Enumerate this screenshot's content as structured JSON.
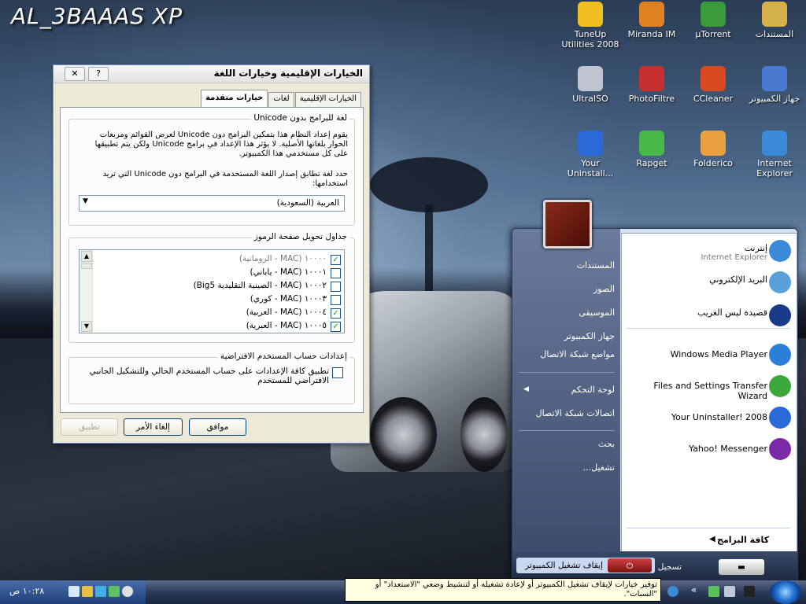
{
  "desktop": {
    "logo": "AL_3BAAAS XP",
    "icons": [
      {
        "label": "TuneUp Utilities 2008",
        "icon": "tuneup-icon",
        "color": "#f0c020"
      },
      {
        "label": "Miranda IM",
        "icon": "miranda-icon",
        "color": "#e08020"
      },
      {
        "label": "µTorrent",
        "icon": "utorrent-icon",
        "color": "#3a9a3a"
      },
      {
        "label": "المستندات",
        "icon": "documents-folder-icon",
        "color": "#d4b04a"
      },
      {
        "label": "UltraISO",
        "icon": "ultraiso-icon",
        "color": "#c0c4d0"
      },
      {
        "label": "PhotoFiltre",
        "icon": "photofiltre-icon",
        "color": "#c83030"
      },
      {
        "label": "CCleaner",
        "icon": "ccleaner-icon",
        "color": "#d84a20"
      },
      {
        "label": "جهاز الكمبيوتر",
        "icon": "my-computer-icon",
        "color": "#4a7ad0"
      },
      {
        "label": "Your Uninstall...",
        "icon": "your-uninstaller-icon",
        "color": "#2a6ad8"
      },
      {
        "label": "Rapget",
        "icon": "rapget-icon",
        "color": "#48b848"
      },
      {
        "label": "Folderico",
        "icon": "folderico-icon",
        "color": "#e8a040"
      },
      {
        "label": "Internet Explorer",
        "icon": "internet-explorer-icon",
        "color": "#3a8ad8"
      }
    ]
  },
  "dialog": {
    "title": "الخيارات الإقليمية وخيارات اللغة",
    "close_label": "✕",
    "help_label": "?",
    "tabs": [
      "الخيارات الإقليمية",
      "لغات",
      "خيارات متقدمة"
    ],
    "active_tab": "خيارات متقدمة",
    "unicode_group": {
      "title": "لغة للبرامج بدون Unicode",
      "description": "يقوم إعداد النظام هذا بتمكين البرامج دون Unicode لعرض القوائم ومربعات الحوار بلغاتها الأصلية. لا يؤثر هذا الإعداد في برامج Unicode ولكن يتم تطبيقها على كل مستخدمي هذا الكمبيوتر.",
      "prompt": "حدد لغة تطابق إصدار اللغة المستخدمة في البرامج دون Unicode التي تريد استخدامها:",
      "selected_language": "العربية (السعودية)"
    },
    "codepage_group": {
      "title": "جداول تحويل صفحة الرموز",
      "rows": [
        {
          "label": "١٠٠٠٠ (MAC - الرومانية)",
          "checked": true,
          "dim": true
        },
        {
          "label": "١٠٠٠١ (MAC - ياباني)",
          "checked": false,
          "dim": false
        },
        {
          "label": "١٠٠٠٢ (MAC - الصينية التقليدية Big5)",
          "checked": false,
          "dim": false
        },
        {
          "label": "١٠٠٠٣ (MAC - كوري)",
          "checked": false,
          "dim": false
        },
        {
          "label": "١٠٠٠٤ (MAC - العربية)",
          "checked": true,
          "dim": false
        },
        {
          "label": "١٠٠٠٥ (MAC - العبرية)",
          "checked": true,
          "dim": false
        }
      ]
    },
    "account_group": {
      "title": "إعدادات حساب المستخدم الافتراضية",
      "checkbox_label": "تطبيق كافة الإعدادات على حساب المستخدم الحالي وللتشكيل الجانبي الافتراضي للمستخدم",
      "checked": false
    },
    "buttons": {
      "ok": "موافق",
      "cancel": "إلغاء الأمر",
      "apply": "تطبيق"
    }
  },
  "start_menu": {
    "pinned": [
      {
        "label": "إنترنت",
        "sub": "Internet Explorer",
        "icon": "internet-explorer-icon",
        "color": "#3a8ad8"
      },
      {
        "label": "البريد الإلكتروني",
        "sub": "",
        "icon": "email-icon",
        "color": "#5aa0d8"
      },
      {
        "label": "قصيدة ليس الغريب",
        "sub": "",
        "icon": "realplayer-icon",
        "color": "#1a3a8a"
      }
    ],
    "recent": [
      {
        "label": "Windows Media Player",
        "icon": "media-player-icon",
        "color": "#2a80d8"
      },
      {
        "label": "Files and Settings Transfer Wizard",
        "icon": "transfer-wizard-icon",
        "color": "#3aa83a"
      },
      {
        "label": "Your Uninstaller! 2008",
        "icon": "your-uninstaller-icon",
        "color": "#2a6ad8"
      },
      {
        "label": "Yahoo! Messenger",
        "icon": "yahoo-messenger-icon",
        "color": "#7a2aa8"
      }
    ],
    "all_programs": "كافة البرامج",
    "places": [
      "المستندات",
      "الصور",
      "الموسيقى",
      "جهاز الكمبيوتر",
      "مواضع شبكة الاتصال",
      "لوحة التحكم",
      "اتصالات شبكة الاتصال",
      "بحث",
      "تشغيل..."
    ],
    "logoff_label": "تسجيل الخروج",
    "shutdown_label": "إيقاف تشغيل الكمبيوتر"
  },
  "tooltip": "توفير خيارات لإيقاف تشغيل الكمبيوتر أو لإعادة تشغيله أو لتنشيط وضعي \"الاستعداد\" أو \"السبات\".",
  "taskbar": {
    "clock": "١٠:٢٨ ص",
    "lang_indicator": "«"
  }
}
